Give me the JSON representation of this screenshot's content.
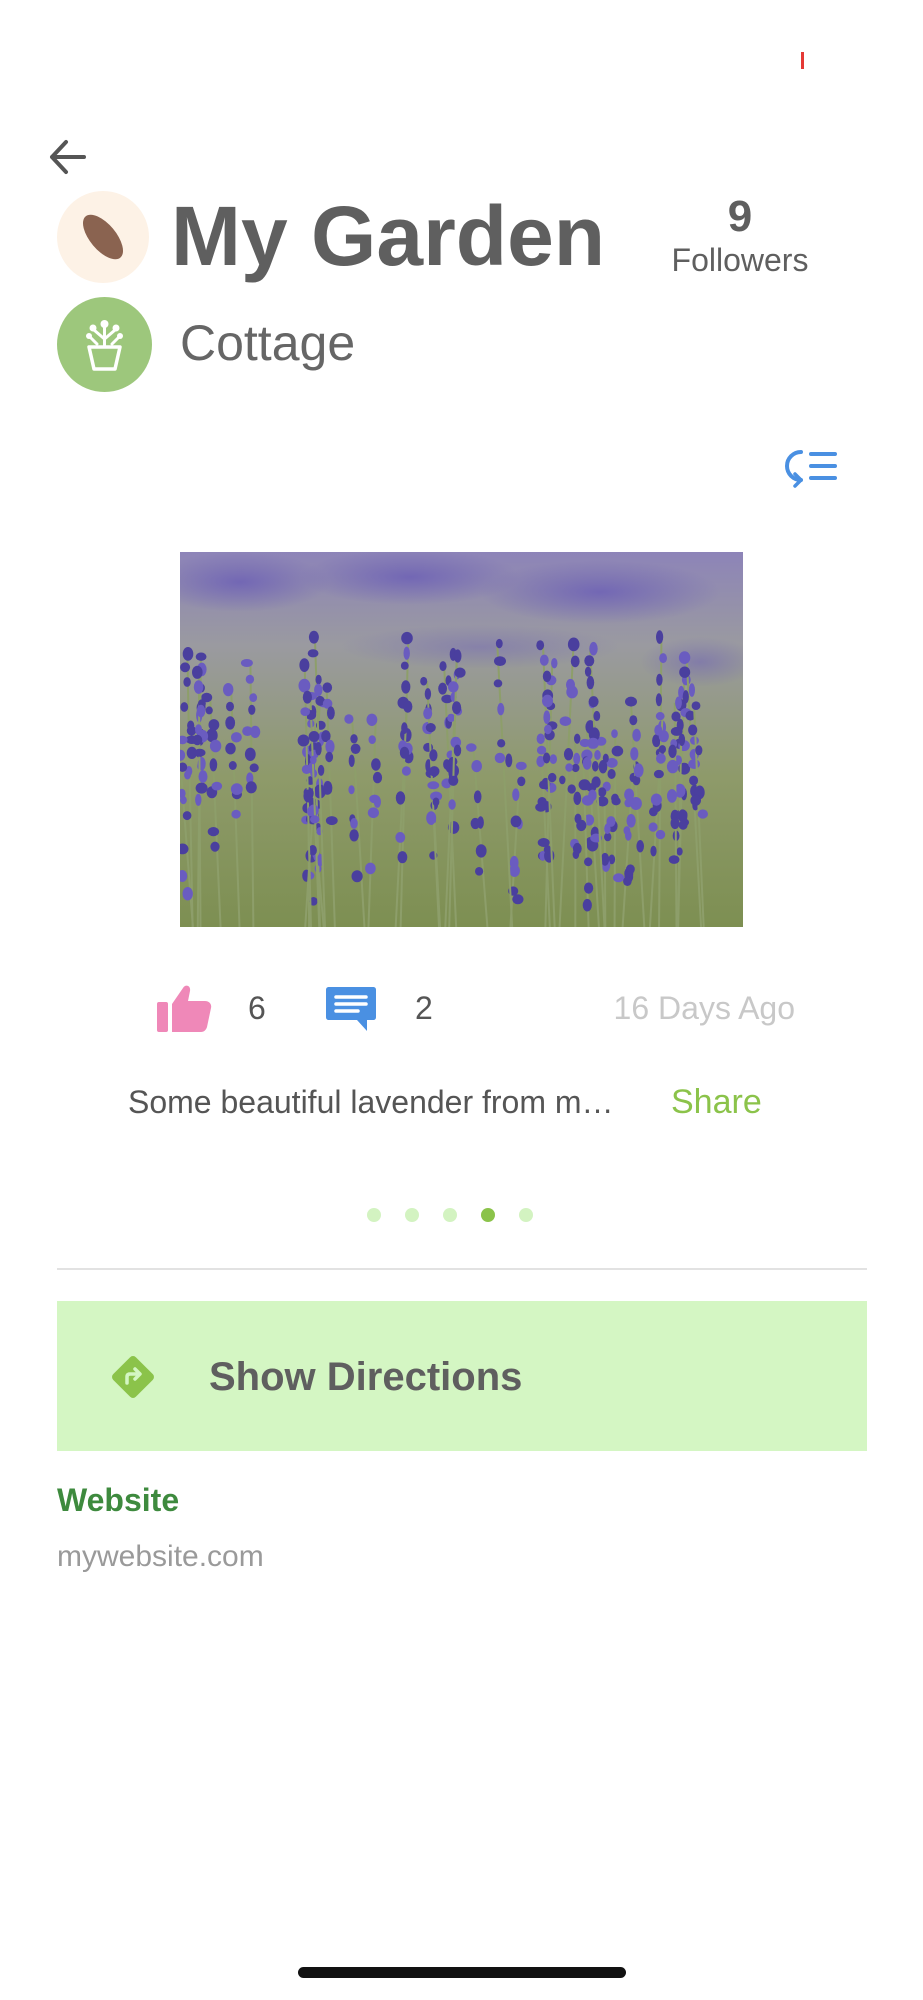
{
  "garden": {
    "title": "My Garden",
    "style": "Cottage",
    "followers_count": "9",
    "followers_label": "Followers"
  },
  "post": {
    "likes": "6",
    "comments": "2",
    "age": "16 Days Ago",
    "caption": "Some beautiful lavender from m…",
    "share_label": "Share",
    "page_count": 5,
    "active_page": 4
  },
  "directions": {
    "label": "Show Directions"
  },
  "website": {
    "heading": "Website",
    "url": "mywebsite.com"
  },
  "icons": {
    "back": "arrow-left-icon",
    "avatar": "seed-icon",
    "style_badge": "planter-icon",
    "comments_sort": "comments-sort-icon",
    "like": "thumbs-up-icon",
    "comment": "comment-icon",
    "directions": "directions-icon"
  },
  "colors": {
    "like": "#ef88b8",
    "comment": "#4a90e2",
    "accent_green": "#8bc34a",
    "directions_bg": "#d4f6c3",
    "website_heading": "#3e8a3e",
    "style_badge_bg": "#9dc77c"
  }
}
